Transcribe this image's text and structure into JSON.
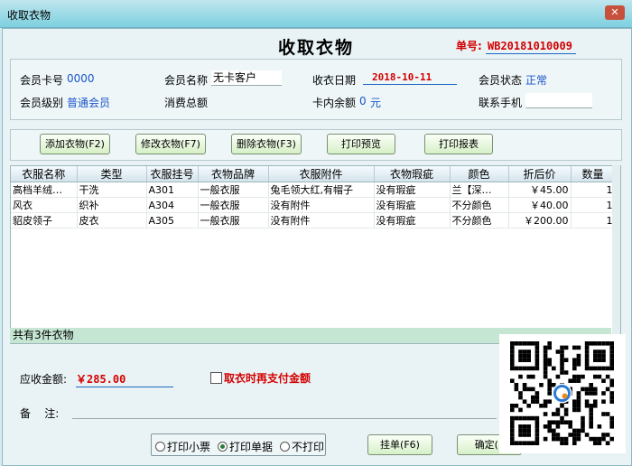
{
  "window": {
    "title": "收取衣物",
    "close_icon": "close-icon"
  },
  "heading": "收取衣物",
  "order": {
    "label": "单号:",
    "value": "WB20181010009"
  },
  "info": {
    "card_no": {
      "label": "会员卡号",
      "value": "0000"
    },
    "member_name": {
      "label": "会员名称",
      "value": "无卡客户"
    },
    "pickup_date": {
      "label": "收衣日期",
      "value": "2018-10-11"
    },
    "member_status": {
      "label": "会员状态",
      "value": "正常"
    },
    "member_level": {
      "label": "会员级别",
      "value": "普通会员"
    },
    "total_spent": {
      "label": "消费总额",
      "value": ""
    },
    "balance": {
      "label": "卡内余额",
      "value": "0",
      "unit": "元"
    },
    "phone": {
      "label": "联系手机",
      "value": ""
    }
  },
  "toolbar": {
    "add": "添加衣物(F2)",
    "edit": "修改衣物(F7)",
    "delete": "删除衣物(F3)",
    "preview": "打印预览",
    "report": "打印报表"
  },
  "table": {
    "columns": [
      "衣服名称",
      "类型",
      "衣服挂号",
      "衣物品牌",
      "衣服附件",
      "衣物瑕疵",
      "颜色",
      "折后价",
      "数量"
    ],
    "rows": [
      [
        "高档羊绒…",
        "干洗",
        "A301",
        "一般衣服",
        "兔毛领大红,有帽子",
        "没有瑕疵",
        "兰【深…",
        "￥45.00",
        "1"
      ],
      [
        "风衣",
        "织补",
        "A304",
        "一般衣服",
        "没有附件",
        "没有瑕疵",
        "不分颜色",
        "￥40.00",
        "1"
      ],
      [
        "貂皮领子",
        "皮衣",
        "A305",
        "一般衣服",
        "没有附件",
        "没有瑕疵",
        "不分颜色",
        "￥200.00",
        "1"
      ]
    ],
    "summary": "共有3件衣物"
  },
  "amount": {
    "label": "应收金额:",
    "value": "￥285.00"
  },
  "pay_on_pickup": {
    "label": "取衣时再支付金额",
    "checked": false
  },
  "note": {
    "label": "备    注:"
  },
  "print_options": {
    "options": [
      "打印小票",
      "打印单据",
      "不打印"
    ],
    "selected": "打印单据"
  },
  "actions": {
    "hang": "挂单(F6)",
    "confirm": "确定(F"
  }
}
